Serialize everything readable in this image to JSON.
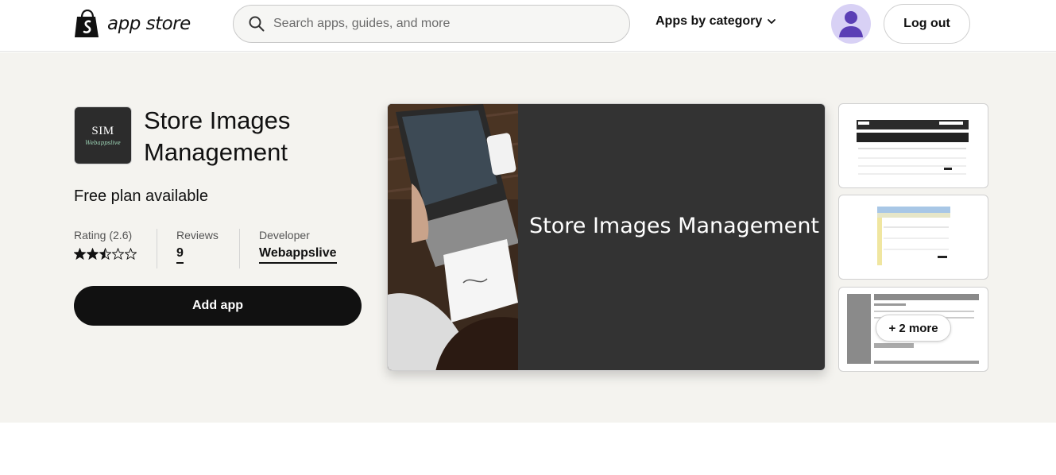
{
  "header": {
    "logo_text": "app store",
    "search_placeholder": "Search apps, guides, and more",
    "category_label": "Apps by category",
    "logout_label": "Log out"
  },
  "app": {
    "icon_text": "SIM",
    "icon_subtext": "Webappslive",
    "title": "Store Images Management",
    "plan": "Free plan available",
    "rating_label": "Rating (2.6)",
    "rating_value": 2.6,
    "reviews_label": "Reviews",
    "reviews_count": "9",
    "developer_label": "Developer",
    "developer_name": "Webappslive",
    "add_button": "Add app"
  },
  "media": {
    "caption": "Store Images Management",
    "more_label": "+ 2 more"
  },
  "colors": {
    "hero_bg": "#f4f3ef",
    "brand_green": "#95bf47",
    "button_dark": "#111111",
    "avatar_bg": "#d8d1f5",
    "avatar_fg": "#5b3fb5"
  }
}
